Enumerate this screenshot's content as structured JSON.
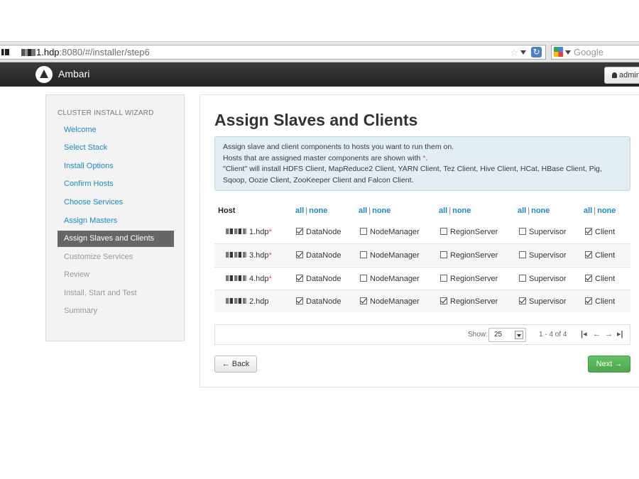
{
  "browser": {
    "url_host_suffix": "1.hdp",
    "url_port_path": ":8080/#/installer/step6",
    "search_placeholder": "Google"
  },
  "navbar": {
    "brand": "Ambari",
    "user_label": "admin"
  },
  "sidebar": {
    "title": "CLUSTER INSTALL WIZARD",
    "items": [
      {
        "label": "Welcome",
        "state": "done"
      },
      {
        "label": "Select Stack",
        "state": "done"
      },
      {
        "label": "Install Options",
        "state": "done"
      },
      {
        "label": "Confirm Hosts",
        "state": "done"
      },
      {
        "label": "Choose Services",
        "state": "done"
      },
      {
        "label": "Assign Masters",
        "state": "done"
      },
      {
        "label": "Assign Slaves and Clients",
        "state": "active"
      },
      {
        "label": "Customize Services",
        "state": "todo"
      },
      {
        "label": "Review",
        "state": "todo"
      },
      {
        "label": "Install, Start and Test",
        "state": "todo"
      },
      {
        "label": "Summary",
        "state": "todo"
      }
    ]
  },
  "main": {
    "title": "Assign Slaves and Clients",
    "alert": {
      "line1": "Assign slave and client components to hosts you want to run them on.",
      "line2_prefix": "Hosts that are assigned master components are shown with",
      "star": "*",
      "line2_suffix": ".",
      "line3": "\"Client\" will install HDFS Client, MapReduce2 Client, YARN Client, Tez Client, Hive Client, HCat, HBase Client, Pig, Sqoop, Oozie Client, ZooKeeper Client and Falcon Client."
    },
    "table": {
      "host_header": "Host",
      "all_label": "all",
      "separator": "|",
      "none_label": "none",
      "components": [
        "DataNode",
        "NodeManager",
        "RegionServer",
        "Supervisor",
        "Client"
      ],
      "rows": [
        {
          "host": "1.hdp",
          "master": "*",
          "checks": [
            true,
            false,
            false,
            false,
            true
          ]
        },
        {
          "host": "3.hdp",
          "master": "*",
          "checks": [
            true,
            false,
            false,
            false,
            true
          ]
        },
        {
          "host": "4.hdp",
          "master": "*",
          "checks": [
            true,
            false,
            false,
            false,
            true
          ]
        },
        {
          "host": "2.hdp",
          "master": "",
          "checks": [
            true,
            true,
            true,
            true,
            true
          ]
        }
      ]
    },
    "pagination": {
      "show_label": "Show:",
      "page_size": "25",
      "range": "1 - 4 of 4"
    },
    "back_label": "← Back",
    "next_label": "Next →"
  },
  "colors": {
    "link": "#1a8ac3",
    "active_step_bg": "#666666",
    "next_button": "#5bb75b",
    "master_star": "#d9534f",
    "alert_bg": "#e3eef4"
  }
}
